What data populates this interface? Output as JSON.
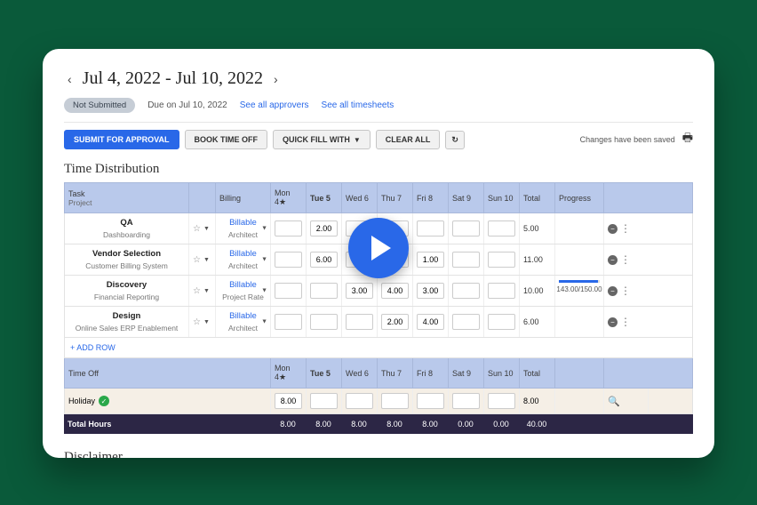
{
  "header": {
    "date_range": "Jul 4, 2022 - Jul 10, 2022",
    "status": "Not Submitted",
    "due": "Due on Jul 10, 2022",
    "approvers_link": "See all approvers",
    "timesheets_link": "See all timesheets"
  },
  "toolbar": {
    "submit": "SUBMIT FOR APPROVAL",
    "book_time_off": "BOOK TIME OFF",
    "quick_fill": "QUICK FILL WITH",
    "clear_all": "CLEAR ALL",
    "saved_msg": "Changes have been saved"
  },
  "sections": {
    "time_distribution": "Time Distribution",
    "disclaimer": "Disclaimer"
  },
  "columns": {
    "task": "Task",
    "task_sub": "Project",
    "billing": "Billing",
    "days": [
      "Mon 4",
      "Tue 5",
      "Wed 6",
      "Thu 7",
      "Fri 8",
      "Sat 9",
      "Sun 10"
    ],
    "total": "Total",
    "progress": "Progress"
  },
  "rows": [
    {
      "task": "QA",
      "project": "Dashboarding",
      "billing": "Billable",
      "billing_sub": "Architect",
      "values": [
        "",
        "2.00",
        "",
        "",
        "",
        "",
        ""
      ],
      "total": "5.00",
      "progress": null
    },
    {
      "task": "Vendor Selection",
      "project": "Customer Billing System",
      "billing": "Billable",
      "billing_sub": "Architect",
      "values": [
        "",
        "6.00",
        "",
        "",
        "1.00",
        "",
        ""
      ],
      "total": "11.00",
      "progress": null
    },
    {
      "task": "Discovery",
      "project": "Financial Reporting",
      "billing": "Billable",
      "billing_sub": "Project Rate",
      "values": [
        "",
        "",
        "3.00",
        "4.00",
        "3.00",
        "",
        ""
      ],
      "total": "10.00",
      "progress": {
        "text": "143.00/150.00",
        "pct": 95
      }
    },
    {
      "task": "Design",
      "project": "Online Sales ERP Enablement",
      "billing": "Billable",
      "billing_sub": "Architect",
      "values": [
        "",
        "",
        "",
        "2.00",
        "4.00",
        "",
        ""
      ],
      "total": "6.00",
      "progress": null
    }
  ],
  "add_row": "+ ADD ROW",
  "time_off_label": "Time Off",
  "time_off": {
    "name": "Holiday",
    "values": [
      "8.00",
      "",
      "",
      "",
      "",
      "",
      ""
    ],
    "total": "8.00"
  },
  "totals": {
    "label": "Total Hours",
    "values": [
      "8.00",
      "8.00",
      "8.00",
      "8.00",
      "8.00",
      "0.00",
      "0.00"
    ],
    "grand": "40.00"
  }
}
